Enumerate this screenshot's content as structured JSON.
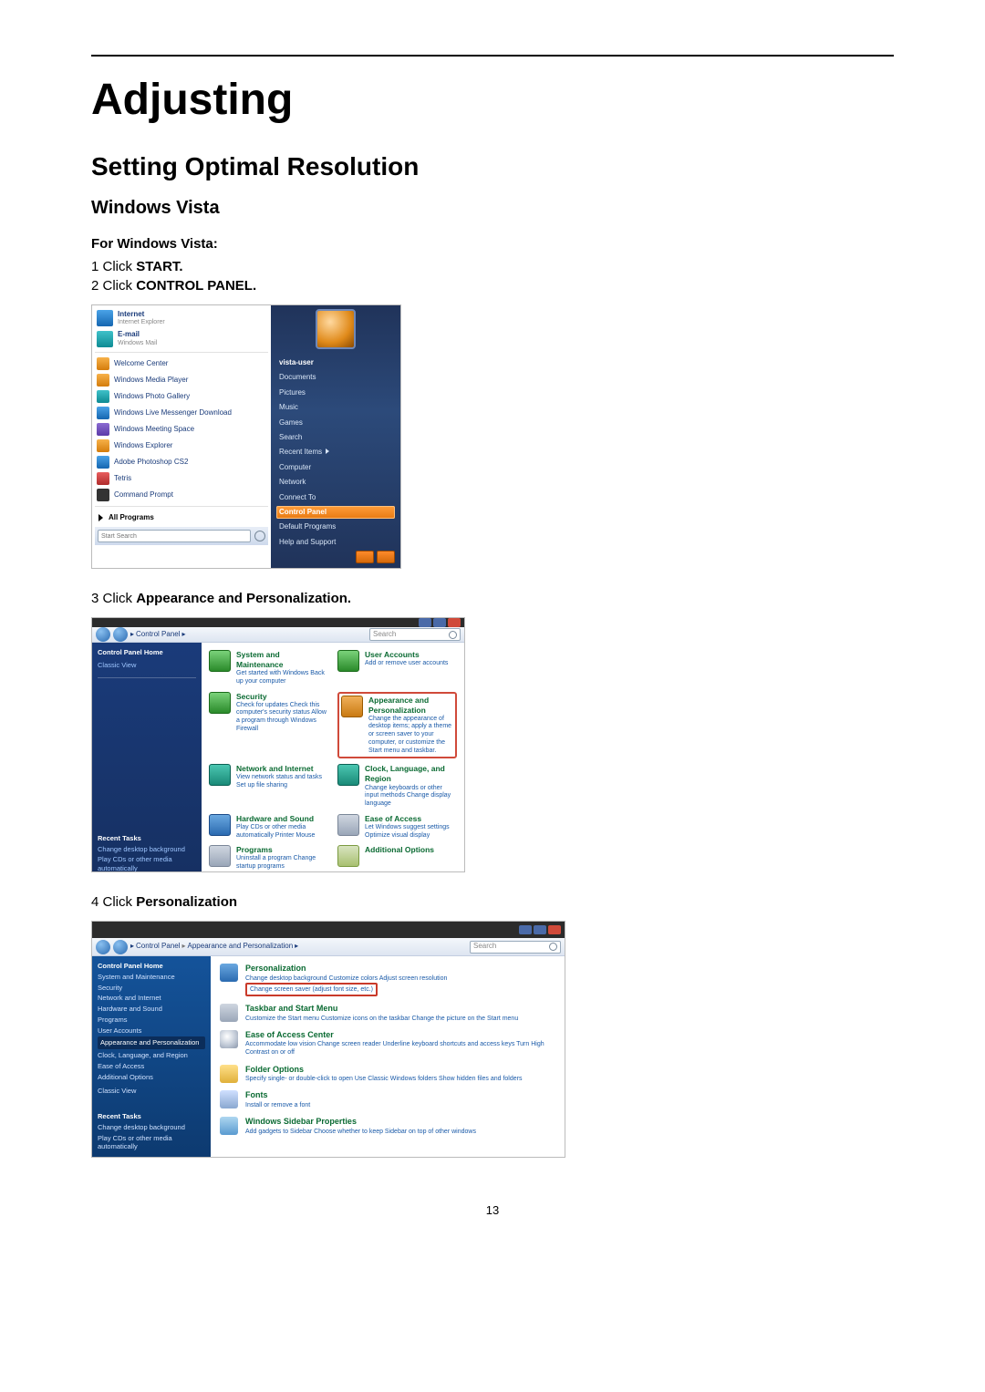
{
  "doc": {
    "title": "Adjusting",
    "section": "Setting Optimal Resolution",
    "subsection": "Windows Vista",
    "intro": "For Windows Vista:",
    "step1_pre": "1 Click ",
    "step1_b": "START.",
    "step2_pre": "2 Click ",
    "step2_b": "CONTROL PANEL.",
    "step3_pre": "3 Click ",
    "step3_b": "Appearance and Personalization.",
    "step4_pre": "4 Click ",
    "step4_b": "Personalization",
    "page_num": "13"
  },
  "start_menu": {
    "left": {
      "internet": "Internet",
      "internet_sub": "Internet Explorer",
      "email": "E-mail",
      "email_sub": "Windows Mail",
      "items": [
        "Welcome Center",
        "Windows Media Player",
        "Windows Photo Gallery",
        "Windows Live Messenger Download",
        "Windows Meeting Space",
        "Windows Explorer",
        "Adobe Photoshop CS2",
        "Tetris",
        "Command Prompt"
      ],
      "all_programs": "All Programs",
      "search_placeholder": "Start Search"
    },
    "right": {
      "user": "vista-user",
      "items": [
        "Documents",
        "Pictures",
        "Music",
        "Games",
        "Search",
        "Recent Items",
        "Computer",
        "Network",
        "Connect To",
        "Control Panel",
        "Default Programs",
        "Help and Support"
      ],
      "highlight_index": 9
    }
  },
  "control_panel": {
    "breadcrumb": "Control Panel",
    "search_placeholder": "Search",
    "left": {
      "home": "Control Panel Home",
      "classic": "Classic View",
      "recent": "Recent Tasks",
      "recent_items": [
        "Change desktop background",
        "Play CDs or other media automatically"
      ]
    },
    "cats": {
      "sys": {
        "t": "System and Maintenance",
        "d": "Get started with Windows\nBack up your computer"
      },
      "user": {
        "t": "User Accounts",
        "d": "Add or remove user accounts"
      },
      "sec": {
        "t": "Security",
        "d": "Check for updates\nCheck this computer's security status\nAllow a program through Windows Firewall"
      },
      "app": {
        "t": "Appearance and Personalization",
        "d": "Change the appearance of desktop items; apply a theme or screen saver to your computer, or customize the Start menu and taskbar."
      },
      "net": {
        "t": "Network and Internet",
        "d": "View network status and tasks\nSet up file sharing"
      },
      "clk": {
        "t": "Clock, Language, and Region",
        "d": "Change keyboards or other input methods\nChange display language"
      },
      "hw": {
        "t": "Hardware and Sound",
        "d": "Play CDs or other media automatically\nPrinter\nMouse"
      },
      "ease": {
        "t": "Ease of Access",
        "d": "Let Windows suggest settings\nOptimize visual display"
      },
      "prog": {
        "t": "Programs",
        "d": "Uninstall a program\nChange startup programs"
      },
      "add": {
        "t": "Additional Options",
        "d": ""
      }
    }
  },
  "appearance": {
    "breadcrumb_1": "Control Panel",
    "breadcrumb_2": "Appearance and Personalization",
    "search_placeholder": "Search",
    "left": {
      "home": "Control Panel Home",
      "items": [
        "System and Maintenance",
        "Security",
        "Network and Internet",
        "Hardware and Sound",
        "Programs",
        "User Accounts",
        "Appearance and Personalization",
        "Clock, Language, and Region",
        "Ease of Access",
        "Additional Options"
      ],
      "current_index": 6,
      "classic": "Classic View",
      "recent": "Recent Tasks",
      "recent_items": [
        "Change desktop background",
        "Play CDs or other media automatically"
      ]
    },
    "rows": {
      "pers": {
        "t": "Personalization",
        "links": "Change desktop background    Customize colors    Adjust screen resolution",
        "boxed": "Change screen saver (adjust font size, etc.)"
      },
      "task": {
        "t": "Taskbar and Start Menu",
        "links": "Customize the Start menu    Customize icons on the taskbar\nChange the picture on the Start menu"
      },
      "ease": {
        "t": "Ease of Access Center",
        "links": "Accommodate low vision    Change screen reader\nUnderline keyboard shortcuts and access keys    Turn High Contrast on or off"
      },
      "fold": {
        "t": "Folder Options",
        "links": "Specify single- or double-click to open    Use Classic Windows folders\nShow hidden files and folders"
      },
      "font": {
        "t": "Fonts",
        "links": "Install or remove a font"
      },
      "side": {
        "t": "Windows Sidebar Properties",
        "links": "Add gadgets to Sidebar    Choose whether to keep Sidebar on top of other windows"
      }
    }
  }
}
